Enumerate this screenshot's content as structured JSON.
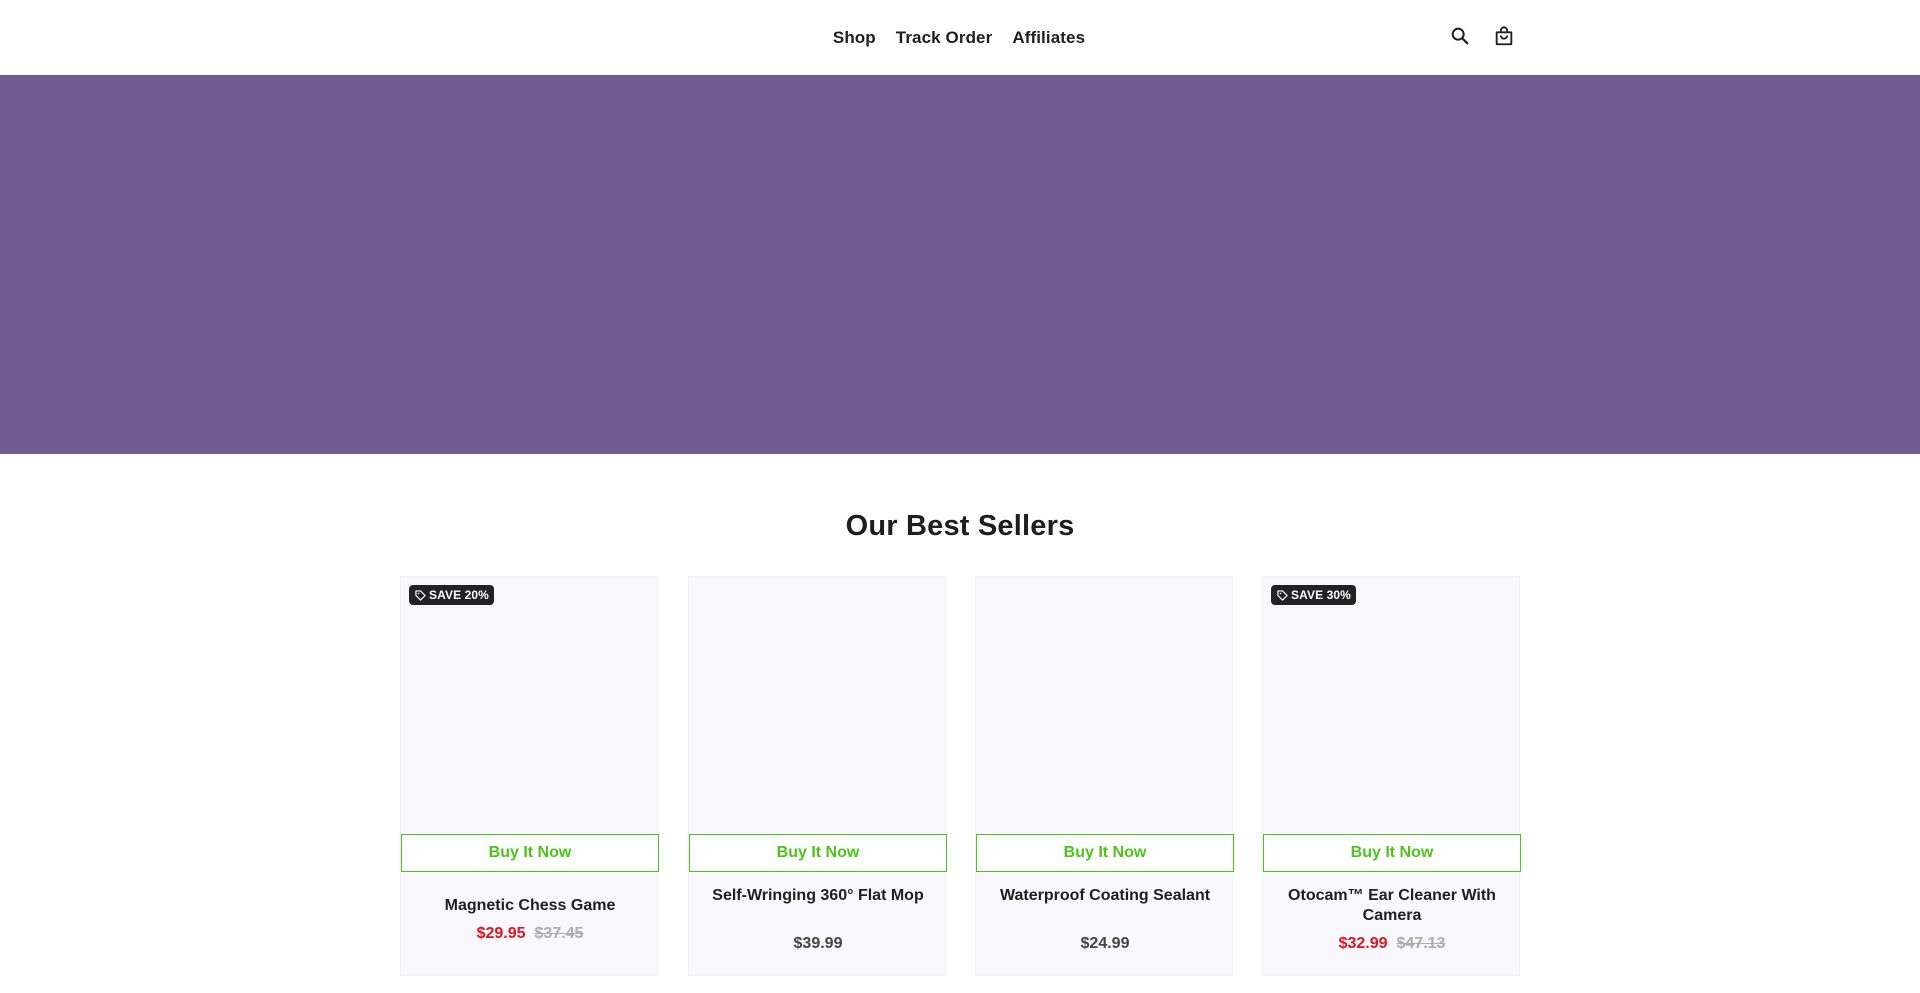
{
  "colors": {
    "hero_background": "#705c93",
    "accent_green": "#4ec41b",
    "sale_red": "#e0141e",
    "badge_background": "#222222",
    "card_background": "#f8f8fd"
  },
  "nav": {
    "items": [
      "Shop",
      "Track Order",
      "Affiliates"
    ]
  },
  "header_icons": {
    "search": "search-icon",
    "cart": "shopping-bag-icon"
  },
  "best_sellers": {
    "title": "Our Best Sellers",
    "buy_label": "Buy It Now",
    "products": [
      {
        "title": "Magnetic Chess Game",
        "badge": "SAVE 20%",
        "price": "$29.95",
        "compare_price": "$37.45"
      },
      {
        "title": "Self-Wringing 360° Flat Mop",
        "badge": "",
        "price": "$39.99",
        "compare_price": ""
      },
      {
        "title": "Waterproof Coating Sealant",
        "badge": "",
        "price": "$24.99",
        "compare_price": ""
      },
      {
        "title": "Otocam™ Ear Cleaner With Camera",
        "badge": "SAVE 30%",
        "price": "$32.99",
        "compare_price": "$47.13"
      }
    ]
  }
}
